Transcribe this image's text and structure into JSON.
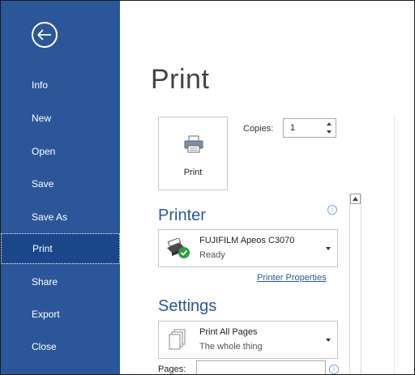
{
  "sidebar": {
    "items": [
      {
        "label": "Info"
      },
      {
        "label": "New"
      },
      {
        "label": "Open"
      },
      {
        "label": "Save"
      },
      {
        "label": "Save As"
      },
      {
        "label": "Print",
        "active": true
      },
      {
        "label": "Share"
      },
      {
        "label": "Export"
      },
      {
        "label": "Close"
      }
    ]
  },
  "main": {
    "title": "Print",
    "print_button_label": "Print",
    "copies_label": "Copies:",
    "copies_value": "1",
    "printer": {
      "section_title": "Printer",
      "name": "FUJIFILM Apeos C3070",
      "status": "Ready",
      "properties_link": "Printer Properties"
    },
    "settings": {
      "section_title": "Settings",
      "range_title": "Print All Pages",
      "range_subtitle": "The whole thing",
      "pages_label": "Pages:",
      "pages_value": ""
    }
  },
  "colors": {
    "sidebar_bg": "#2b579a",
    "sidebar_active": "#19478a",
    "accent": "#2b579a"
  }
}
